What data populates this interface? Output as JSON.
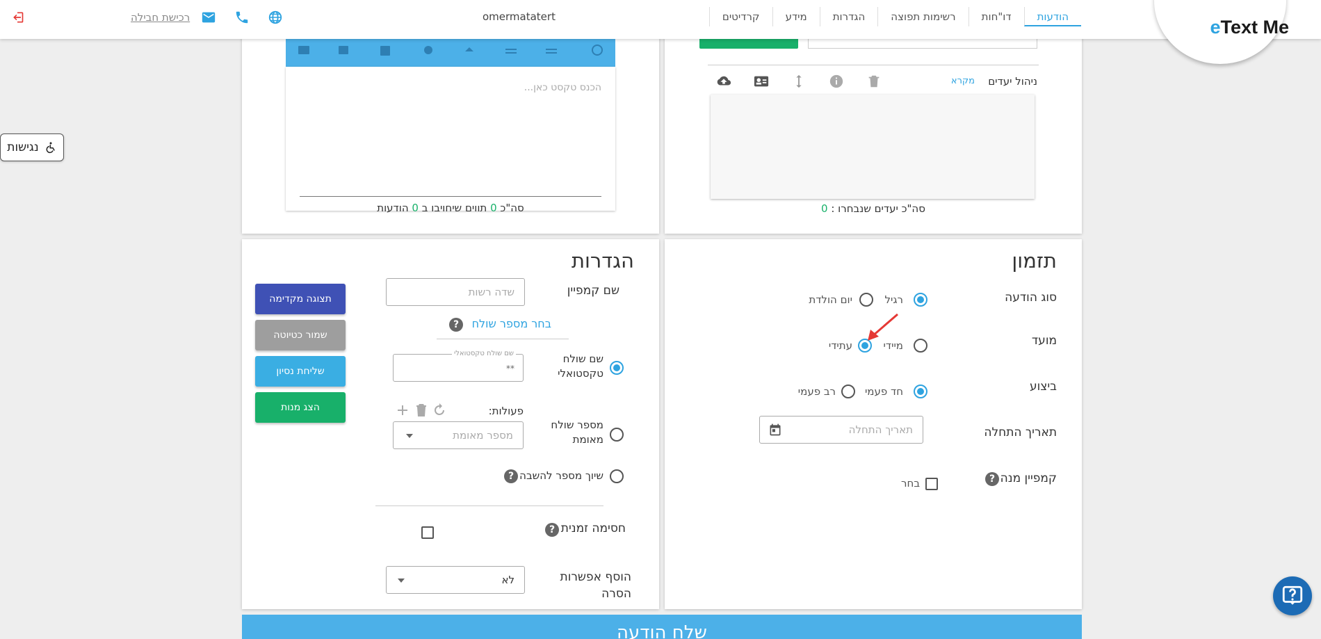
{
  "nav": {
    "items": [
      "הודעות",
      "דו\"חות",
      "רשימות תפוצה",
      "הגדרות",
      "מידע",
      "קרדיטים"
    ],
    "active": "הודעות"
  },
  "logo": {
    "prefix": "e",
    "text": "Text Me"
  },
  "header": {
    "username": "omermatatert",
    "buy_package": "רכישת חבילה"
  },
  "icons": {
    "logout": "logout-icon",
    "mail": "mail-icon",
    "phone": "phone-icon",
    "globe": "globe-icon",
    "upload": "cloud-upload-icon",
    "contact": "contact-card-icon",
    "sort": "sort-vertical-icon",
    "info": "info-icon",
    "trash": "trash-icon",
    "calendar": "calendar-icon",
    "refresh": "refresh-icon",
    "add": "plus-icon",
    "accessibility": "wheelchair-icon",
    "help": "help-chat-icon"
  },
  "accessibility": {
    "label": "נגישות"
  },
  "editor": {
    "placeholder": "הכנס טקסט כאן...",
    "count_prefix": "סה\"כ",
    "chars": "0",
    "count_middle": "תווים שיחויבו ב",
    "messages": "0",
    "count_suffix": "הודעות"
  },
  "targets": {
    "title": "ניהול יעדים",
    "legend_link": "מקרא",
    "selected_prefix": "סה\"כ יעדים שנבחרו :",
    "selected_count": "0"
  },
  "scheduling": {
    "heading": "תזמון",
    "message_type_label": "סוג הודעה",
    "message_type_options": [
      "רגיל",
      "יום הולדת"
    ],
    "timing_label": "מועד",
    "timing_options": [
      "מיידי",
      "עתידי"
    ],
    "execution_label": "ביצוע",
    "execution_options": [
      "חד פעמי",
      "רב פעמי"
    ],
    "start_date_label": "תאריך התחלה",
    "start_date_placeholder": "תאריך התחלה",
    "subscription_label": "קמפיין מנה",
    "subscription_choose": "בחר"
  },
  "settings": {
    "heading": "הגדרות",
    "campaign_name_label": "שם קמפיין",
    "campaign_name_placeholder": "שדה רשות",
    "choose_sender": "בחר מספר שולח",
    "text_sender_label": "שם שולח טקסטואלי",
    "text_sender_float": "שם שולח טקסטואלי",
    "text_sender_value": "**",
    "actions_label": "פעולות:",
    "verified_sender_label": "מספר שולח מאומת",
    "verified_placeholder": "מספר מאומת",
    "reply_label": "שיוך מספר להשבה",
    "temp_block_label": "חסימה זמנית",
    "add_remove_label": "הוסף אפשרות הסרה",
    "add_remove_value": "לא"
  },
  "buttons": {
    "preview": "תצוגה מקדימה",
    "save_draft": "שמור כטיוטה",
    "test_send": "שליחת נסיון",
    "show_subs": "הצג מנות",
    "send": "שלח הודעה"
  },
  "colors": {
    "accent": "#2ea3e0",
    "green": "#18b06a",
    "preview": "#3f51b5",
    "draft": "#9e9e9e",
    "test": "#3aaee3",
    "fab": "#1c6bb5"
  }
}
